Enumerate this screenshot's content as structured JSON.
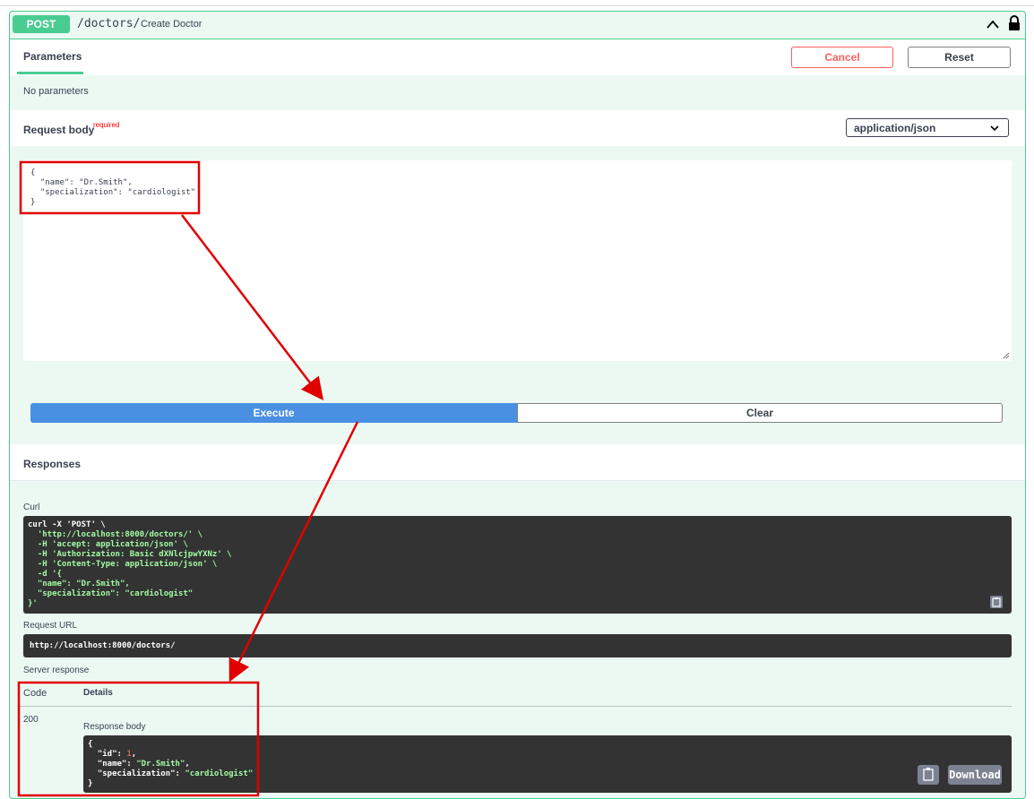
{
  "operation": {
    "method": "POST",
    "path": "/doctors/",
    "summary": "Create Doctor"
  },
  "parameters": {
    "tab_label": "Parameters",
    "cancel_label": "Cancel",
    "reset_label": "Reset",
    "empty_text": "No parameters"
  },
  "request_body": {
    "title": "Request body",
    "required_label": "required",
    "content_type": "application/json",
    "lines": [
      "{",
      "  \"name\": \"Dr.Smith\",",
      "  \"specialization\": \"cardiologist\"",
      "}"
    ]
  },
  "actions": {
    "execute_label": "Execute",
    "clear_label": "Clear"
  },
  "responses": {
    "title": "Responses",
    "curl_label": "Curl",
    "curl_lines": [
      "curl -X 'POST' \\",
      "  'http://localhost:8000/doctors/' \\",
      "  -H 'accept: application/json' \\",
      "  -H 'Authorization: Basic dXNlcjpwYXNz' \\",
      "  -H 'Content-Type: application/json' \\",
      "  -d '{",
      "  \"name\": \"Dr.Smith\",",
      "  \"specialization\": \"cardiologist\"",
      "}'"
    ],
    "request_url_label": "Request URL",
    "request_url": "http://localhost:8000/doctors/",
    "server_response_label": "Server response",
    "code_header": "Code",
    "details_header": "Details",
    "status_code": "200",
    "response_body_label": "Response body",
    "response_lines": [
      "{",
      "  \"id\": 1,",
      "  \"name\": \"Dr.Smith\",",
      "  \"specialization\": \"cardiologist\"",
      "}"
    ],
    "download_label": "Download"
  },
  "colors": {
    "post_green": "#49cc90",
    "execute_blue": "#4990e2",
    "annotation_red": "#e00000"
  }
}
